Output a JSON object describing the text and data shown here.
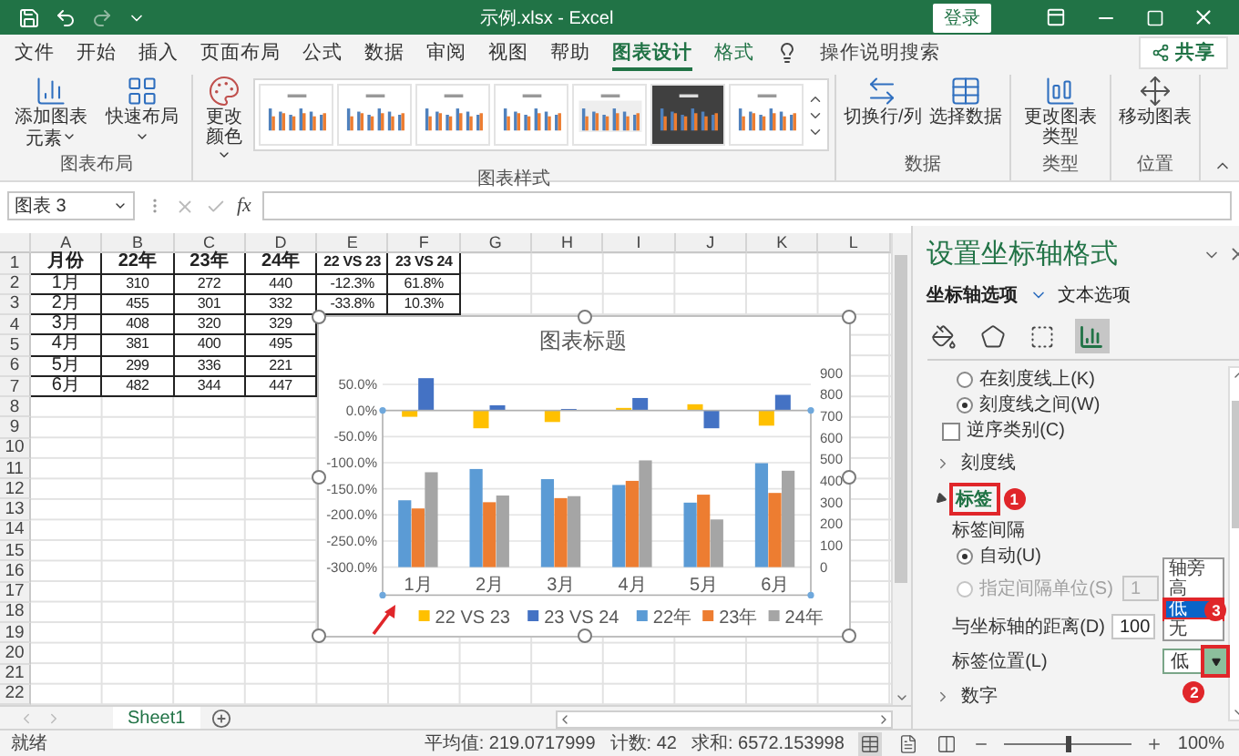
{
  "window": {
    "title": "示例.xlsx  -  Excel",
    "sign_in": "登录"
  },
  "tabs": [
    {
      "label": "文件",
      "selected": false,
      "contextual": false
    },
    {
      "label": "开始",
      "selected": false,
      "contextual": false
    },
    {
      "label": "插入",
      "selected": false,
      "contextual": false
    },
    {
      "label": "页面布局",
      "selected": false,
      "contextual": false
    },
    {
      "label": "公式",
      "selected": false,
      "contextual": false
    },
    {
      "label": "数据",
      "selected": false,
      "contextual": false
    },
    {
      "label": "审阅",
      "selected": false,
      "contextual": false
    },
    {
      "label": "视图",
      "selected": false,
      "contextual": false
    },
    {
      "label": "帮助",
      "selected": false,
      "contextual": false
    },
    {
      "label": "图表设计",
      "selected": true,
      "contextual": true
    },
    {
      "label": "格式",
      "selected": false,
      "contextual": true
    }
  ],
  "tell_me": "操作说明搜索",
  "share": "共享",
  "ribbon": {
    "groups": [
      {
        "label": "图表布局",
        "buttons": [
          {
            "label": "添加图表元素",
            "kind": "add-element",
            "dropdown": true
          },
          {
            "label": "快速布局",
            "kind": "quick-layout",
            "dropdown": true
          }
        ]
      },
      {
        "label": "图表样式",
        "buttons": [
          {
            "label": "更改颜色",
            "kind": "colors",
            "dropdown": true
          }
        ],
        "gallery": [
          {
            "kind": "plain"
          },
          {
            "kind": "plain"
          },
          {
            "kind": "plain"
          },
          {
            "kind": "plain"
          },
          {
            "kind": "hatched"
          },
          {
            "kind": "dark"
          },
          {
            "kind": "plain"
          }
        ]
      },
      {
        "label": "数据",
        "buttons": [
          {
            "label": "切换行/列",
            "kind": "switch",
            "dropdown": false
          },
          {
            "label": "选择数据",
            "kind": "select-data",
            "dropdown": false
          }
        ]
      },
      {
        "label": "类型",
        "buttons": [
          {
            "label": "更改图表类型",
            "kind": "change-type",
            "dropdown": false
          }
        ]
      },
      {
        "label": "位置",
        "buttons": [
          {
            "label": "移动图表",
            "kind": "move",
            "dropdown": false
          }
        ]
      }
    ]
  },
  "formula_bar": {
    "name_box": "图表 3",
    "function_label": "fx"
  },
  "sheet": {
    "columns": [
      "A",
      "B",
      "C",
      "D",
      "E",
      "F",
      "G",
      "H",
      "I",
      "J",
      "K",
      "L"
    ],
    "rows": [
      {
        "number": "1",
        "kind": "header",
        "cells": [
          "月份",
          "22年",
          "23年",
          "24年",
          "22 VS 23",
          "23 VS 24"
        ]
      },
      {
        "number": "2",
        "kind": "data",
        "cells": [
          "1月",
          "310",
          "272",
          "440",
          "-12.3%",
          "61.8%"
        ]
      },
      {
        "number": "3",
        "kind": "data",
        "cells": [
          "2月",
          "455",
          "301",
          "332",
          "-33.8%",
          "10.3%"
        ]
      },
      {
        "number": "4",
        "kind": "data",
        "cells": [
          "3月",
          "408",
          "320",
          "329"
        ]
      },
      {
        "number": "5",
        "kind": "data",
        "cells": [
          "4月",
          "381",
          "400",
          "495"
        ]
      },
      {
        "number": "6",
        "kind": "data",
        "cells": [
          "5月",
          "299",
          "336",
          "221"
        ]
      },
      {
        "number": "7",
        "kind": "data",
        "cells": [
          "6月",
          "482",
          "344",
          "447"
        ]
      },
      {
        "number": "8",
        "kind": "blank"
      },
      {
        "number": "9",
        "kind": "blank"
      },
      {
        "number": "10",
        "kind": "blank"
      },
      {
        "number": "11",
        "kind": "blank"
      },
      {
        "number": "12",
        "kind": "blank"
      },
      {
        "number": "13",
        "kind": "blank"
      },
      {
        "number": "14",
        "kind": "blank"
      },
      {
        "number": "15",
        "kind": "blank"
      },
      {
        "number": "16",
        "kind": "blank"
      },
      {
        "number": "17",
        "kind": "blank"
      },
      {
        "number": "18",
        "kind": "blank"
      },
      {
        "number": "19",
        "kind": "blank"
      },
      {
        "number": "20",
        "kind": "blank"
      },
      {
        "number": "21",
        "kind": "blank"
      },
      {
        "number": "22",
        "kind": "blank"
      }
    ]
  },
  "chart": {
    "chart_data": {
      "type": "bar",
      "title": "图表标题",
      "stacked": false,
      "grid": true,
      "legend": "bottom",
      "categories": [
        "1月",
        "2月",
        "3月",
        "4月",
        "5月",
        "6月"
      ],
      "series": [
        {
          "name": "22 VS 23",
          "color": "#ffc000",
          "values": [
            -12,
            -34,
            -22,
            5,
            12,
            -29
          ]
        },
        {
          "name": "23 VS 24",
          "color": "#4472c4",
          "values": [
            62,
            10,
            3,
            24,
            -34,
            30
          ]
        },
        {
          "name": "22年",
          "color": "#5b9bd5",
          "axis": "y2",
          "values": [
            310,
            455,
            408,
            381,
            299,
            482
          ]
        },
        {
          "name": "23年",
          "color": "#ed7d31",
          "axis": "y2",
          "values": [
            272,
            301,
            320,
            400,
            336,
            344
          ]
        },
        {
          "name": "24年",
          "color": "#a5a5a5",
          "axis": "y2",
          "values": [
            440,
            332,
            329,
            495,
            221,
            447
          ]
        }
      ],
      "ylim": [
        -300,
        70
      ],
      "yticks": [
        {
          "value": 50,
          "label": "50.0%"
        },
        {
          "value": 0,
          "label": "0.0%"
        },
        {
          "value": -50,
          "label": "-50.0%"
        },
        {
          "value": -100,
          "label": "-100.0%"
        },
        {
          "value": -150,
          "label": "-150.0%"
        },
        {
          "value": -200,
          "label": "-200.0%"
        },
        {
          "value": -250,
          "label": "-250.0%"
        },
        {
          "value": -300,
          "label": "-300.0%"
        }
      ],
      "y2lim": [
        0,
        900
      ],
      "y2ticks": [
        0,
        100,
        200,
        300,
        400,
        500,
        600,
        700,
        800,
        900
      ]
    }
  },
  "sheet_tabs": [
    {
      "label": "Sheet1",
      "selected": true
    }
  ],
  "format_pane": {
    "title": "设置坐标轴格式",
    "tabs": [
      {
        "label": "坐标轴选项",
        "selected": true
      },
      {
        "label": "文本选项",
        "selected": false
      }
    ],
    "icon_tabs": [
      {
        "kind": "fill",
        "selected": false
      },
      {
        "kind": "effects",
        "selected": false
      },
      {
        "kind": "size",
        "selected": false
      },
      {
        "kind": "axis",
        "selected": true
      }
    ],
    "options": [
      {
        "kind": "radio",
        "label": "在刻度线上(K)",
        "selected": false,
        "disabled": false
      },
      {
        "kind": "radio",
        "label": "刻度线之间(W)",
        "selected": true,
        "disabled": false
      },
      {
        "kind": "checkbox",
        "label": "逆序类别(C)",
        "checked": false
      },
      {
        "kind": "section",
        "label": "刻度线",
        "expanded": false
      },
      {
        "kind": "section",
        "label": "标签",
        "expanded": true,
        "callout": "1"
      },
      {
        "kind": "caption",
        "label": "标签间隔"
      },
      {
        "kind": "radio",
        "label": "自动(U)",
        "selected": true,
        "disabled": false
      },
      {
        "kind": "radio",
        "label": "指定间隔单位(S)",
        "selected": false,
        "disabled": true,
        "value": "1"
      },
      {
        "kind": "field",
        "label": "与坐标轴的距离(D)",
        "value": "100"
      },
      {
        "kind": "dropdown",
        "label": "标签位置(L)",
        "value": "低",
        "callout": "2",
        "expanded": true,
        "options": [
          {
            "label": "轴旁",
            "selected": false
          },
          {
            "label": "高",
            "selected": false
          },
          {
            "label": "低",
            "selected": true,
            "callout": "3"
          },
          {
            "label": "无",
            "selected": false
          }
        ]
      },
      {
        "kind": "section",
        "label": "数字",
        "expanded": false
      }
    ]
  },
  "status_bar": {
    "mode": "就绪",
    "stats": [
      "平均值: 219.0717999",
      "计数: 42",
      "求和: 6572.153998"
    ],
    "views": [
      {
        "kind": "normal",
        "selected": true
      },
      {
        "kind": "page-layout",
        "selected": false
      },
      {
        "kind": "page-break",
        "selected": false
      }
    ],
    "zoom": {
      "label": "100%",
      "level": 0.5
    }
  }
}
